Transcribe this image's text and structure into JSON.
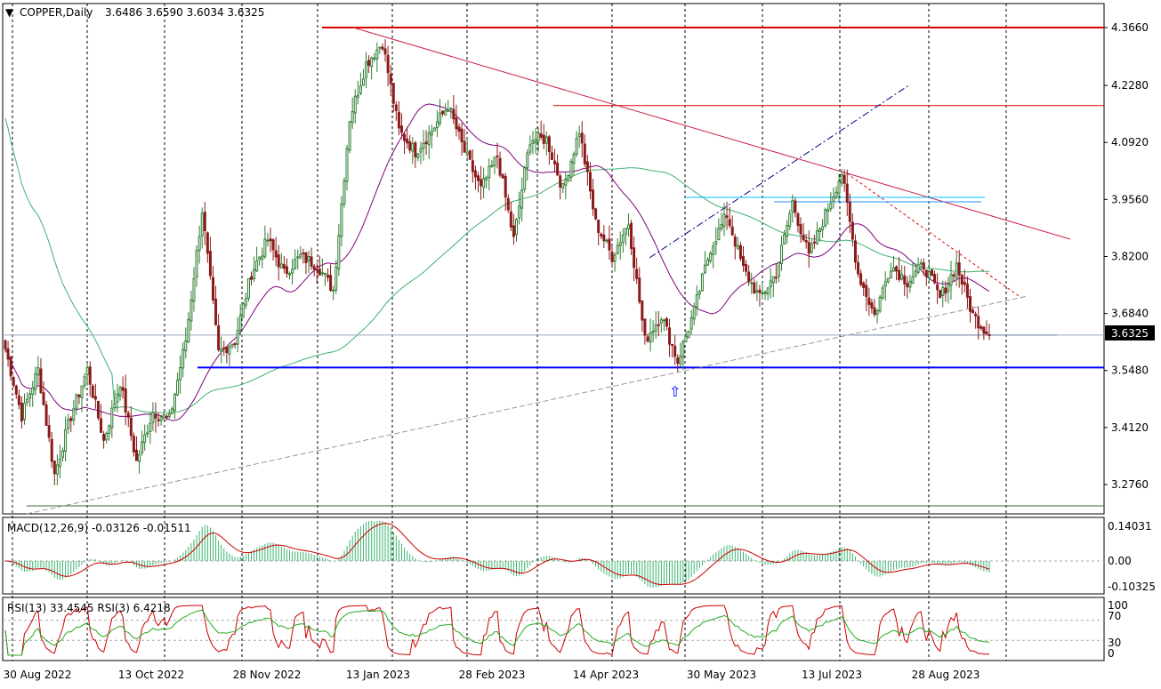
{
  "header": {
    "symbol_label": "COPPER,Daily",
    "ohlc_text": "3.6486 3.6590 3.6034 3.6325"
  },
  "price_axis": {
    "ticks": [
      "4.3660",
      "4.2280",
      "4.0920",
      "3.9560",
      "3.8200",
      "3.6840",
      "3.5480",
      "3.4120",
      "3.2760"
    ],
    "current_price": "3.6325"
  },
  "macd": {
    "label": "MACD(12,26,9) -0.03126 -0.01511",
    "ticks": [
      "0.14031",
      "0.00",
      "-0.10325"
    ]
  },
  "rsi": {
    "label": "RSI(13) 33.4545  RSI(3) 6.4218",
    "ticks": [
      "100",
      "70",
      "30",
      "0"
    ]
  },
  "time_axis": {
    "ticks": [
      "30 Aug 2022",
      "13 Oct 2022",
      "28 Nov 2022",
      "13 Jan 2023",
      "28 Feb 2023",
      "14 Apr 2023",
      "30 May 2023",
      "13 Jul 2023",
      "28 Aug 2023"
    ]
  },
  "colors": {
    "bull_candle": "#2e7d32",
    "bear_candle": "#8b1a1a",
    "ma_fast": "#800080",
    "ma_slow": "#3cb371",
    "resistance": "#e00000",
    "support": "#0000ff",
    "macd_hist": "#3cb371",
    "macd_signal": "#cc0000",
    "rsi13": "#22aa22",
    "rsi3": "#cc0000"
  },
  "chart_data": {
    "type": "candlestick",
    "title": "COPPER,Daily",
    "ylim": [
      3.2485,
      4.378
    ],
    "x": [
      "30 Aug 2022",
      "13 Oct 2022",
      "28 Nov 2022",
      "13 Jan 2023",
      "28 Feb 2023",
      "14 Apr 2023",
      "30 May 2023",
      "13 Jul 2023",
      "28 Aug 2023"
    ],
    "close_path": [
      3.6,
      3.44,
      3.55,
      3.3,
      3.44,
      3.55,
      3.38,
      3.52,
      3.33,
      3.45,
      3.43,
      3.62,
      3.93,
      3.59,
      3.62,
      3.78,
      3.86,
      3.78,
      3.82,
      3.8,
      3.74,
      4.15,
      4.28,
      4.33,
      4.12,
      4.07,
      4.12,
      4.18,
      4.07,
      3.98,
      4.06,
      3.86,
      4.1,
      4.1,
      3.98,
      4.12,
      3.9,
      3.82,
      3.9,
      3.62,
      3.68,
      3.57,
      3.69,
      3.84,
      3.92,
      3.79,
      3.72,
      3.78,
      3.95,
      3.82,
      3.92,
      4.02,
      3.78,
      3.68,
      3.8,
      3.76,
      3.8,
      3.72,
      3.8,
      3.68,
      3.6325
    ],
    "last_ohlc": {
      "open": 3.6486,
      "high": 3.659,
      "low": 3.6034,
      "close": 3.6325
    },
    "levels": {
      "resistance_top": 4.366,
      "resistance_mid": 4.18,
      "support": 3.555,
      "base": 3.225
    }
  }
}
